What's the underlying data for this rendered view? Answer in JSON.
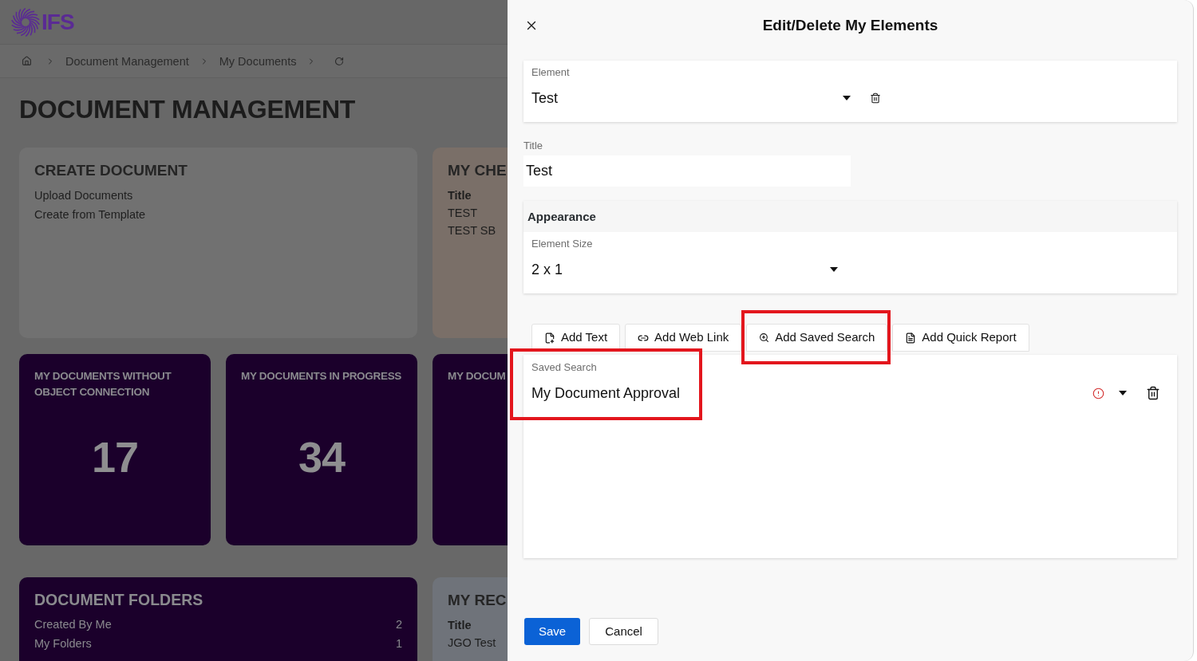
{
  "header": {
    "logo_text": "IFS"
  },
  "breadcrumb": [
    "Document Management",
    "My Documents"
  ],
  "page_title": "DOCUMENT MANAGEMENT",
  "tile_rows": [
    [
      {
        "kind": "links",
        "color": "#717171",
        "title": "CREATE DOCUMENT",
        "links": [
          "Upload Documents",
          "Create from Template"
        ]
      },
      {
        "kind": "list",
        "color": "#7a6f68",
        "title": "MY CHE",
        "column": "Title",
        "rows": [
          "TEST",
          "TEST SB"
        ]
      }
    ],
    [
      {
        "kind": "counter",
        "color": "#1b002b",
        "title": "MY DOCUMENTS WITHOUT OBJECT CONNECTION",
        "value": "17"
      },
      {
        "kind": "counter",
        "color": "#1b002b",
        "title": "MY DOCUMENTS IN PROGRESS",
        "value": "34"
      },
      {
        "kind": "counter",
        "color": "#1b002b",
        "title": "MY DOCUM"
      }
    ],
    [
      {
        "kind": "folders",
        "color": "#1b002b",
        "title": "DOCUMENT FOLDERS",
        "rows": [
          {
            "label": "Created By Me",
            "count": "2"
          },
          {
            "label": "My Folders",
            "count": "1"
          }
        ]
      },
      {
        "kind": "list",
        "color": "#6f737a",
        "title": "MY REC",
        "column": "Title",
        "rows": [
          "JGO Test"
        ]
      }
    ]
  ],
  "drawer": {
    "title": "Edit/Delete My Elements",
    "element": {
      "label": "Element",
      "value": "Test"
    },
    "title_field": {
      "label": "Title",
      "value": "Test"
    },
    "appearance": {
      "heading": "Appearance",
      "size_label": "Element Size",
      "size_value": "2 x 1"
    },
    "add_buttons": [
      {
        "kind": "text",
        "label": "Add Text",
        "highlighted": false
      },
      {
        "kind": "web_link",
        "label": "Add Web Link",
        "highlighted": false
      },
      {
        "kind": "saved_search",
        "label": "Add Saved Search",
        "highlighted": true
      },
      {
        "kind": "quick_report",
        "label": "Add Quick Report",
        "highlighted": false
      }
    ],
    "items": [
      {
        "kind": "saved_search",
        "label": "Saved Search",
        "value": "My Document Approval",
        "warning": true,
        "highlighted": true
      }
    ],
    "actions": [
      {
        "kind": "primary",
        "label": "Save"
      },
      {
        "kind": "secondary",
        "label": "Cancel"
      }
    ]
  }
}
